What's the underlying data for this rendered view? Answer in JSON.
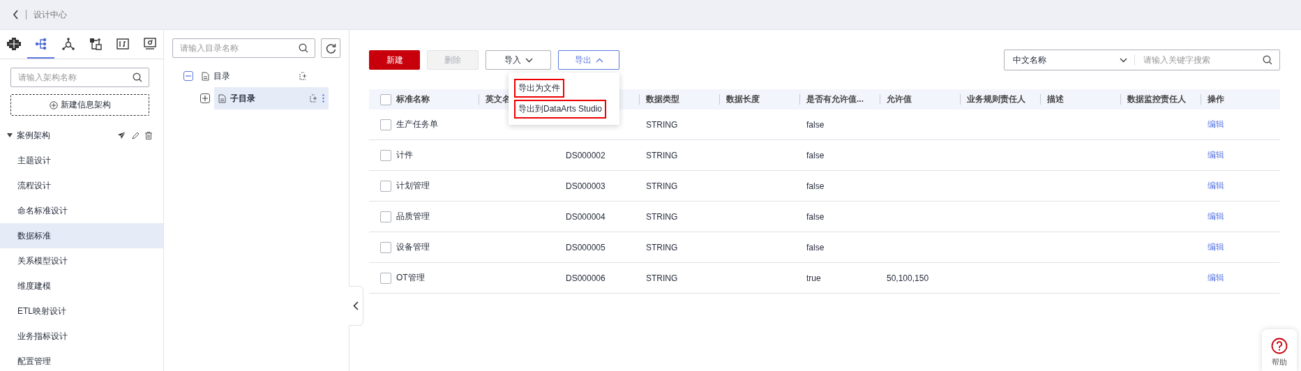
{
  "header": {
    "title": "设计中心"
  },
  "sidebar": {
    "tabs": [
      {
        "kind": "grid",
        "selected": false
      },
      {
        "kind": "branch",
        "selected": true
      },
      {
        "kind": "hub",
        "selected": false
      },
      {
        "kind": "flow",
        "selected": false
      },
      {
        "kind": "book",
        "selected": false
      },
      {
        "kind": "monitor",
        "selected": false
      }
    ],
    "search": {
      "placeholder": "请输入架构名称"
    },
    "new_button": "新建信息架构",
    "tree": {
      "label": "案例架构",
      "expanded": true,
      "children": [
        {
          "label": "主题设计",
          "selected": false
        },
        {
          "label": "流程设计",
          "selected": false
        },
        {
          "label": "命名标准设计",
          "selected": false
        },
        {
          "label": "数据标准",
          "selected": true
        },
        {
          "label": "关系模型设计",
          "selected": false
        },
        {
          "label": "维度建模",
          "selected": false
        },
        {
          "label": "ETL映射设计",
          "selected": false
        },
        {
          "label": "业务指标设计",
          "selected": false
        },
        {
          "label": "配置管理",
          "selected": false
        }
      ]
    }
  },
  "catalog": {
    "search": {
      "placeholder": "请输入目录名称"
    },
    "tree": [
      {
        "label": "目录",
        "expanded": true,
        "selected": false,
        "children": [
          {
            "label": "子目录",
            "expanded": false,
            "selected": true
          }
        ]
      }
    ]
  },
  "toolbar": {
    "buttons": [
      {
        "label": "新建",
        "kind": "primary"
      },
      {
        "label": "删除",
        "kind": "plain",
        "disabled": true
      },
      {
        "label": "导入",
        "kind": "dropdown",
        "expanded": false
      },
      {
        "label": "导出",
        "kind": "dropdown",
        "expanded": true
      }
    ],
    "export_menu": [
      {
        "label": "导出为文件",
        "highlighted": true
      },
      {
        "label": "导出到DataArts Studio",
        "highlighted": true
      }
    ]
  },
  "search": {
    "field": "中文名称",
    "placeholder": "请输入关键字搜索"
  },
  "table": {
    "all_checked": false,
    "columns": [
      "标准名称",
      "英文名",
      null,
      "数据类型",
      "数据长度",
      "是否有允许值...",
      "允许值",
      "业务规则责任人",
      "描述",
      "数据监控责任人",
      "操作"
    ],
    "rows": [
      {
        "checked": false,
        "cells": [
          "生产任务单",
          null,
          null,
          "STRING",
          null,
          "false",
          null,
          null,
          null,
          null,
          "编辑"
        ]
      },
      {
        "checked": false,
        "cells": [
          "计件",
          null,
          "DS000002",
          "STRING",
          null,
          "false",
          null,
          null,
          null,
          null,
          "编辑"
        ]
      },
      {
        "checked": false,
        "cells": [
          "计划管理",
          null,
          "DS000003",
          "STRING",
          null,
          "false",
          null,
          null,
          null,
          null,
          "编辑"
        ]
      },
      {
        "checked": false,
        "cells": [
          "品质管理",
          null,
          "DS000004",
          "STRING",
          null,
          "false",
          null,
          null,
          null,
          null,
          "编辑"
        ]
      },
      {
        "checked": false,
        "cells": [
          "设备管理",
          null,
          "DS000005",
          "STRING",
          null,
          "false",
          null,
          null,
          null,
          null,
          "编辑"
        ]
      },
      {
        "checked": false,
        "cells": [
          "OT管理",
          null,
          "DS000006",
          "STRING",
          null,
          "true",
          "50,100,150",
          null,
          null,
          null,
          "编辑"
        ]
      }
    ]
  },
  "help": {
    "label": "帮助"
  }
}
